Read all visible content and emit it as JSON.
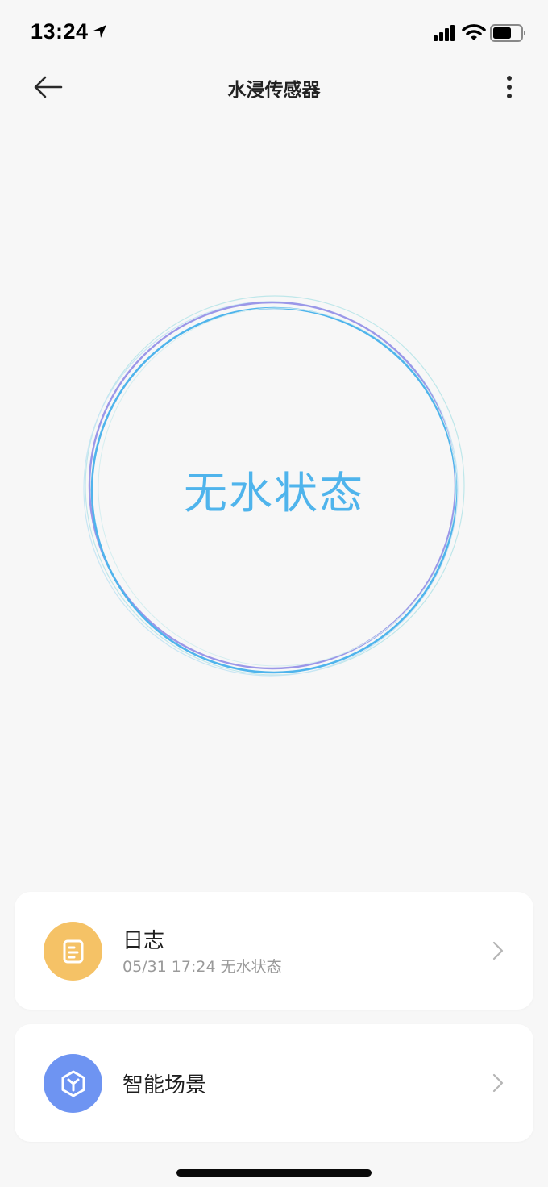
{
  "status_bar": {
    "time": "13:24",
    "icons": [
      "location-arrow-icon",
      "signal-icon",
      "wifi-icon",
      "battery-icon"
    ]
  },
  "nav": {
    "title": "水浸传感器",
    "back_icon": "arrow-left-icon",
    "more_icon": "more-vertical-icon"
  },
  "status": {
    "text": "无水状态",
    "color": "#4fb4ec",
    "ring_colors": [
      "#4fb4ec",
      "#9b97e8",
      "#bfe7ea"
    ]
  },
  "cards": [
    {
      "title": "日志",
      "subtitle": "05/31 17:24 无水状态",
      "icon": "log-document-icon",
      "icon_color": "#f5c266"
    },
    {
      "title": "智能场景",
      "icon": "smart-scene-icon",
      "icon_color": "#6e94f2"
    }
  ]
}
